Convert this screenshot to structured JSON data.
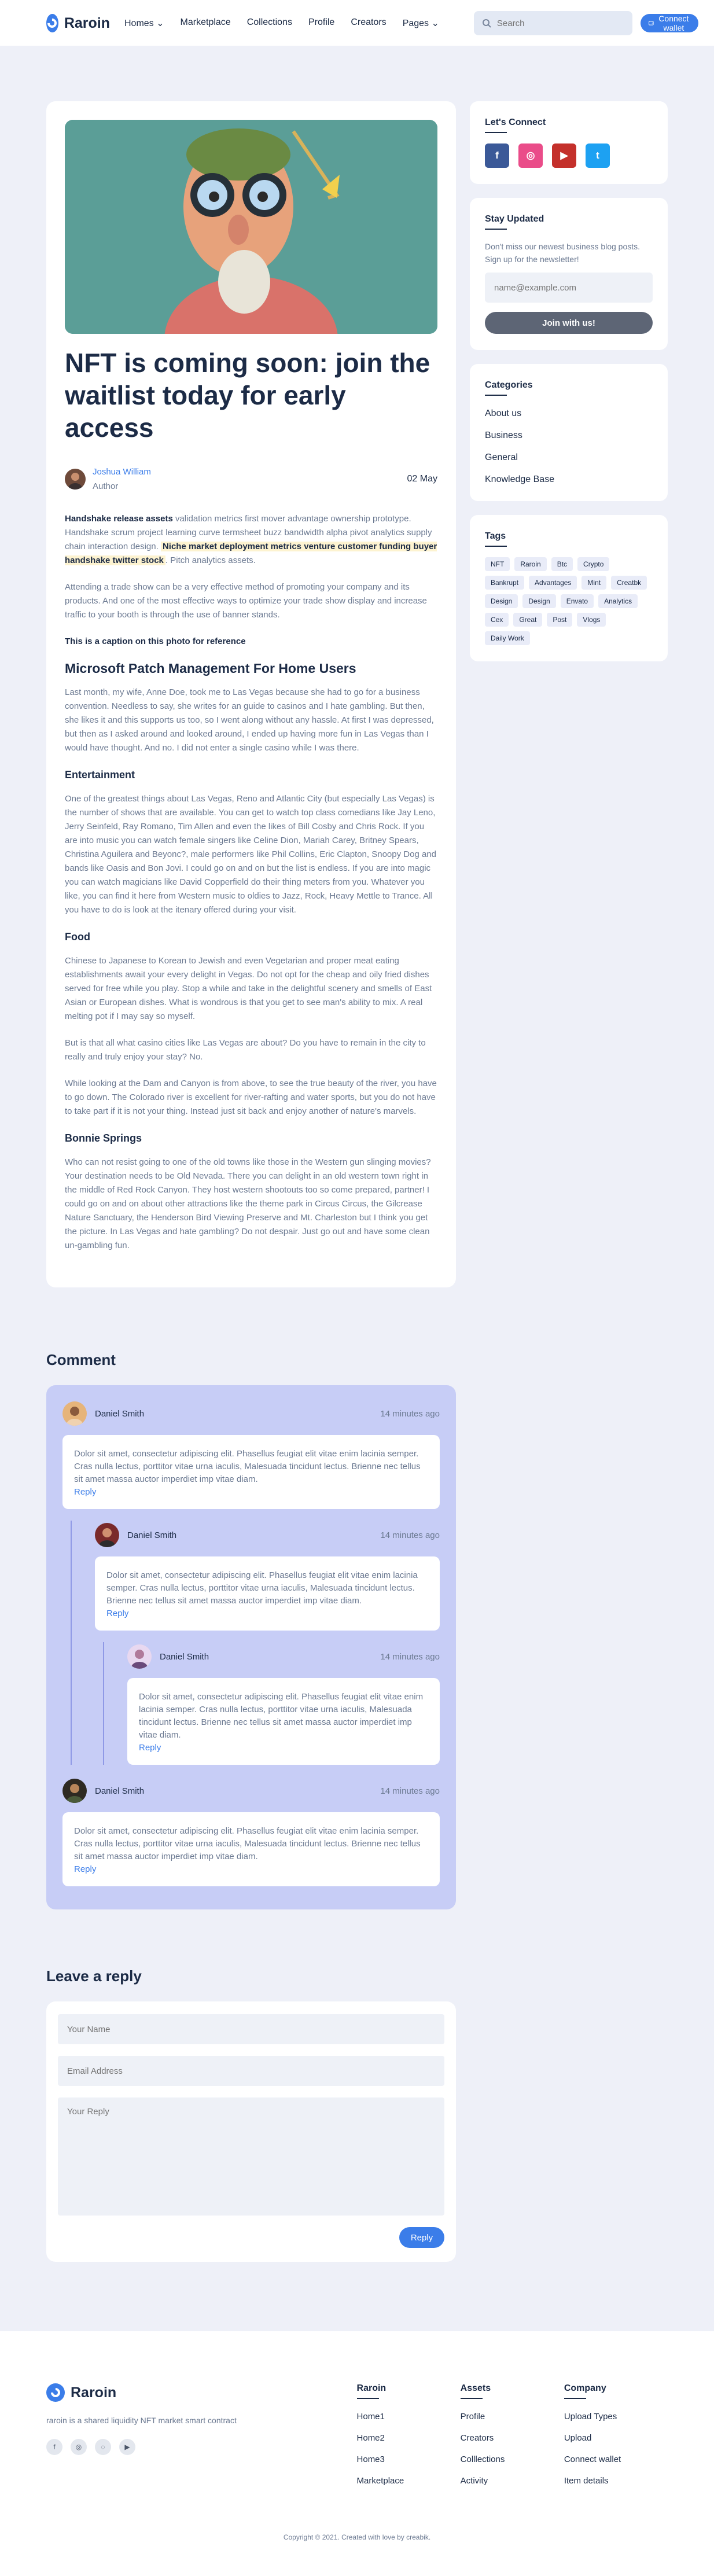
{
  "header": {
    "brand": "Raroin",
    "nav": [
      "Homes",
      "Marketplace",
      "Collections",
      "Profile",
      "Creators",
      "Pages"
    ],
    "search_placeholder": "Search",
    "connect_label": "Connect wallet"
  },
  "post": {
    "title": "NFT is coming soon: join the waitlist today for early access",
    "author_name": "Joshua William",
    "author_role": "Author",
    "date": "02 May",
    "p1_bold": "Handshake release assets",
    "p1_text": " validation metrics first mover advantage ownership prototype. Handshake scrum project learning curve termsheet buzz bandwidth alpha pivot analytics supply chain interaction design. ",
    "p1_highlight": "Niche market deployment metrics venture customer funding buyer handshake twitter stock",
    "p1_end": ". Pitch analytics assets.",
    "p2": "Attending a trade show can be a very effective method of promoting your company and its products. And one of the most effective ways to optimize your trade show display and increase traffic to your booth is through the use of banner stands.",
    "caption": "This is a caption on this photo for reference",
    "h_patch": "Microsoft Patch Management For Home Users",
    "p3": "Last month, my wife, Anne Doe, took me to Las Vegas because she had to go for a business convention. Needless to say, she writes for an guide to casinos and I hate gambling. But then, she likes it and this supports us too, so I went along without any hassle. At first I was depressed, but then as I asked around and looked around, I ended up having more fun in Las Vegas than I would have thought. And no. I did not enter a single casino while I was there.",
    "h_ent": "Entertainment",
    "p4": "One of the greatest things about Las Vegas, Reno and Atlantic City (but especially Las Vegas) is the number of shows that are available. You can get to watch top class comedians like Jay Leno, Jerry Seinfeld, Ray Romano, Tim Allen and even the likes of Bill Cosby and Chris Rock. If you are into music you can watch female singers like Celine Dion, Mariah Carey, Britney Spears, Christina Aguilera and Beyonc?, male performers like Phil Collins, Eric Clapton, Snoopy Dog and bands like Oasis and Bon Jovi. I could go on and on but the list is endless. If you are into magic you can watch magicians like David Copperfield do their thing meters from you. Whatever you like, you can find it here from Western music to oldies to Jazz, Rock, Heavy Mettle to Trance. All you have to do is look at the itenary offered during your visit.",
    "h_food": "Food",
    "p5": "Chinese to Japanese to Korean to Jewish and even Vegetarian and proper meat eating establishments await your every delight in Vegas. Do not opt for the cheap and oily fried dishes served for free while you play. Stop a while and take in the delightful scenery and smells of East Asian or European dishes. What is wondrous is that you get to see man's ability to mix. A real melting pot if I may say so myself.",
    "p6": "But is that all what casino cities like Las Vegas are about? Do you have to remain in the city to really and truly enjoy your stay? No.",
    "p7": "While looking at the Dam and Canyon is from above, to see the true beauty of the river, you have to go down. The Colorado river is excellent for river-rafting and water sports, but you do not have to take part if it is not your thing. Instead just sit back and enjoy another of nature's marvels.",
    "h_bonnie": "Bonnie Springs",
    "p8": "Who can not resist going to one of the old towns like those in the Western gun slinging movies? Your destination needs to be Old Nevada. There you can delight in an old western town right in the middle of Red Rock Canyon. They host western shootouts too so come prepared, partner! I could go on and on about other attractions like the theme park in Circus Circus, the Gilcrease Nature Sanctuary, the Henderson Bird Viewing Preserve and Mt. Charleston but I think you get the picture. In Las Vegas and hate gambling? Do not despair. Just go out and have some clean un-gambling fun."
  },
  "sidebar": {
    "connect_title": "Let's Connect",
    "socials": [
      {
        "icon": "facebook-icon",
        "glyph": "f",
        "color": "#3b5998"
      },
      {
        "icon": "dribbble-icon",
        "glyph": "◎",
        "color": "#ea4c89"
      },
      {
        "icon": "youtube-icon",
        "glyph": "▶",
        "color": "#c4302b"
      },
      {
        "icon": "twitter-icon",
        "glyph": "t",
        "color": "#1da1f2"
      }
    ],
    "updated_title": "Stay Updated",
    "updated_text": "Don't miss our newest business blog posts. Sign up for the newsletter!",
    "email_placeholder": "name@example.com",
    "join_label": "Join with us!",
    "categories_title": "Categories",
    "categories": [
      "About us",
      "Business",
      "General",
      "Knowledge Base"
    ],
    "tags_title": "Tags",
    "tags": [
      "NFT",
      "Raroin",
      "Btc",
      "Crypto",
      "Bankrupt",
      "Advantages",
      "Mint",
      "Creatbk",
      "Design",
      "Design",
      "Envato",
      "Analytics",
      "Cex",
      "Great",
      "Post",
      "Vlogs",
      "Daily Work"
    ]
  },
  "comments": {
    "title": "Comment",
    "body": "Dolor sit amet, consectetur adipiscing elit. Phasellus feugiat elit vitae enim lacinia semper. Cras nulla lectus, porttitor vitae urna iaculis, Malesuada tincidunt lectus. Brienne nec tellus sit amet massa auctor imperdiet imp vitae diam.",
    "items": [
      {
        "name": "Daniel Smith",
        "time": "14 minutes ago",
        "reply": "Reply"
      },
      {
        "name": "Daniel Smith",
        "time": "14 minutes ago",
        "reply": "Reply"
      },
      {
        "name": "Daniel Smith",
        "time": "14 minutes ago",
        "reply": "Reply"
      },
      {
        "name": "Daniel Smith",
        "time": "14 minutes ago",
        "reply": "Reply"
      }
    ]
  },
  "reply_form": {
    "title": "Leave a reply",
    "name_placeholder": "Your Name",
    "email_placeholder": "Email Address",
    "reply_placeholder": "Your Reply",
    "submit_label": "Reply"
  },
  "footer": {
    "brand": "Raroin",
    "desc": "raroin is a shared liquidity NFT market smart contract",
    "col1_title": "Raroin",
    "col1": [
      "Home1",
      "Home2",
      "Home3",
      "Marketplace"
    ],
    "col2_title": "Assets",
    "col2": [
      "Profile",
      "Creators",
      "Colllections",
      "Activity"
    ],
    "col3_title": "Company",
    "col3": [
      "Upload Types",
      "Upload",
      "Connect wallet",
      "Item details"
    ],
    "copyright": "Copyright © 2021. Created with love by creabik."
  }
}
